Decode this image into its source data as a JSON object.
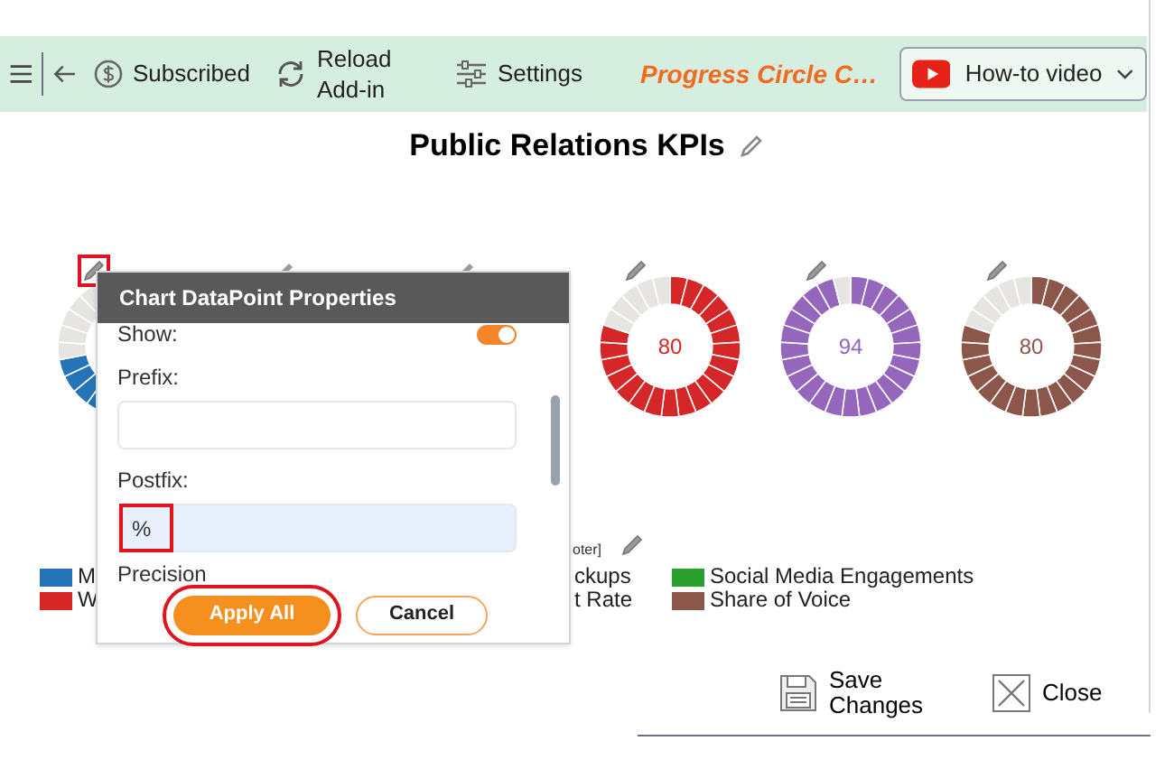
{
  "toolbar": {
    "subscribed": "Subscribed",
    "reload": "Reload Add-in",
    "settings": "Settings",
    "add_in_name": "Progress Circle C…",
    "video_button": "How-to video"
  },
  "title": "Public Relations KPIs",
  "donuts": [
    {
      "color": "#2574b8",
      "level": 0.72,
      "pencil_highlighted": true
    },
    {
      "color": "#d62728",
      "level": 0.8,
      "value": "80",
      "pencil_highlighted": false
    },
    {
      "color": "#9467bd",
      "level": 0.94,
      "value": "94",
      "pencil_highlighted": false
    },
    {
      "color": "#8c564b",
      "level": 0.8,
      "value": "80",
      "pencil_highlighted": false
    }
  ],
  "legend": {
    "footer_label": "oter]",
    "items": [
      {
        "label": "M",
        "color": "#2574b8"
      },
      {
        "label": "W",
        "color": "#d62728"
      },
      {
        "label": "ckups"
      },
      {
        "label": "t Rate"
      },
      {
        "label": "Social Media Engagements",
        "color": "#2ca02c"
      },
      {
        "label": "Share of Voice",
        "color": "#8c564b"
      }
    ]
  },
  "dialog": {
    "title": "Chart DataPoint Properties",
    "fields": [
      {
        "kind": "toggle",
        "label": "Show:",
        "on": true
      },
      {
        "kind": "text",
        "label": "Prefix:",
        "highlighted": false
      },
      {
        "kind": "text",
        "label": "Postfix:",
        "value": "%",
        "highlighted": true
      },
      {
        "kind": "label",
        "label": "Precision"
      }
    ],
    "buttons": [
      {
        "label": "Apply All",
        "kind": "primary",
        "highlighted": true
      },
      {
        "label": "Cancel",
        "kind": "secondary",
        "highlighted": false
      }
    ]
  },
  "footer": {
    "save": "Save Changes",
    "close": "Close"
  }
}
